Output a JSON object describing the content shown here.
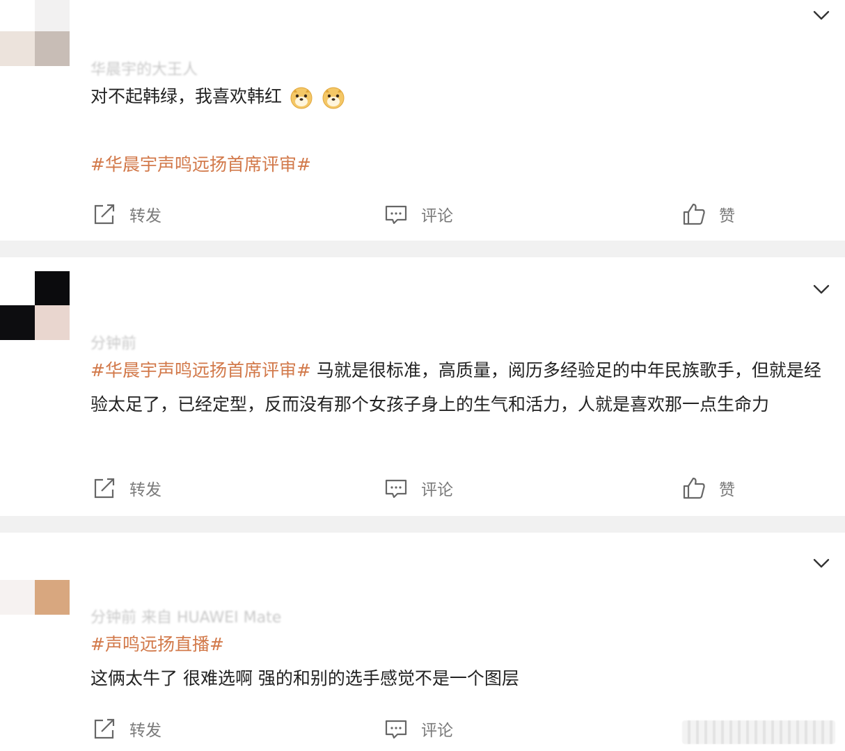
{
  "posts": [
    {
      "meta": "华晨宇的大王人",
      "text": "对不起韩绿，我喜欢韩红",
      "emoji_icon": "doge-emoji",
      "hashtag": "#华晨宇声鸣远扬首席评审#",
      "actions": {
        "repost": "转发",
        "comment": "评论",
        "like": "赞"
      }
    },
    {
      "meta": "分钟前",
      "hashtag": "#华晨宇声鸣远扬首席评审#",
      "text": " 马就是很标准，高质量，阅历多经验足的中年民族歌手，但就是经验太足了，已经定型，反而没有那个女孩子身上的生气和活力，人就是喜欢那一点生命力",
      "actions": {
        "repost": "转发",
        "comment": "评论",
        "like": "赞"
      }
    },
    {
      "meta": "分钟前  来自 HUAWEI Mate",
      "hashtag": "#声鸣远扬直播#",
      "text": "这俩太牛了 很难选啊 强的和别的选手感觉不是一个图层",
      "actions": {
        "repost": "转发",
        "comment": "评论"
      }
    }
  ],
  "colors": {
    "hashtag": "#d2794a",
    "divider": "#f1f1f1",
    "action_text": "#7a7a7a"
  },
  "icons": [
    "chevron-down-icon",
    "repost-icon",
    "comment-icon",
    "like-icon",
    "doge-emoji"
  ]
}
